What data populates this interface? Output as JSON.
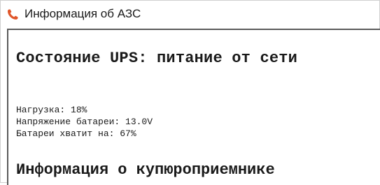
{
  "window": {
    "title": "Информация об АЗС",
    "icon": "phone-handset-icon",
    "icon_color": "#e0562a"
  },
  "ups": {
    "status_heading": "Состояние UPS: питание от сети",
    "load_line": "Нагрузка: 18%",
    "battery_voltage_line": "Напряжение батареи: 13.0V",
    "battery_remaining_line": "Батареи хватит на: 67%"
  },
  "bill_acceptor": {
    "heading": "Информация о купюроприемнике"
  }
}
